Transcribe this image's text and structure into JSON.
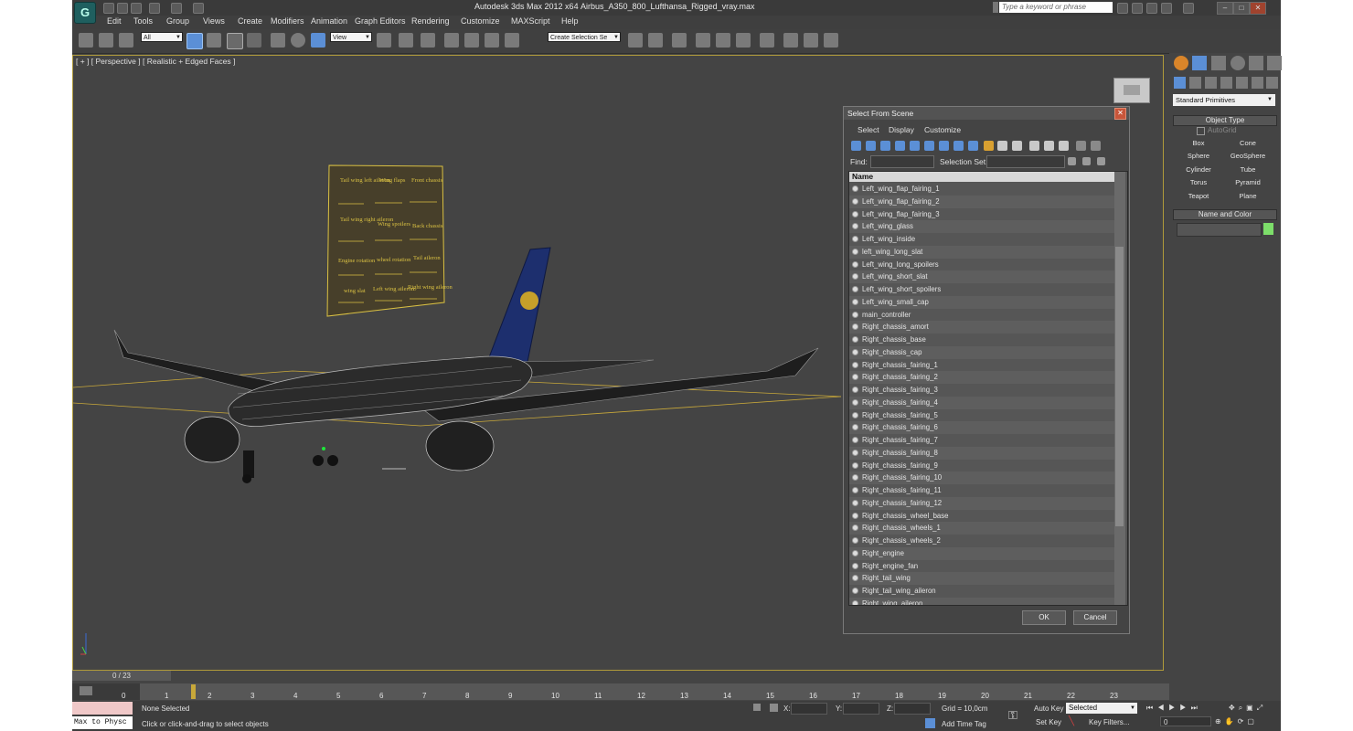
{
  "app": {
    "title": "Autodesk 3ds Max  2012 x64",
    "file": "Airbus_A350_800_Lufthansa_Rigged_vray.max",
    "search_placeholder": "Type a keyword or phrase"
  },
  "menu": [
    "Edit",
    "Tools",
    "Group",
    "Views",
    "Create",
    "Modifiers",
    "Animation",
    "Graph Editors",
    "Rendering",
    "Customize",
    "MAXScript",
    "Help"
  ],
  "toolbar": {
    "filter_value": "All",
    "view_value": "View",
    "selection_set_value": "Create Selection Se"
  },
  "viewport": {
    "label": "[ + ] [ Perspective ] [ Realistic + Edged Faces ]",
    "controller_labels": [
      "Tail wing left aileron",
      "Wing flaps",
      "Front chassis",
      "Tail wing right aileron",
      "Wing spoilers",
      "Back chassis",
      "Engine rotation",
      "wheel rotation",
      "Tail aileron",
      "wing slat",
      "Left wing aileron",
      "Right wing aileron"
    ]
  },
  "dialog": {
    "title": "Select From Scene",
    "menu": [
      "Select",
      "Display",
      "Customize"
    ],
    "find_label": "Find:",
    "selection_set_label": "Selection Set:",
    "column_header": "Name",
    "items": [
      "Left_wing_flap_fairing_1",
      "Left_wing_flap_fairing_2",
      "Left_wing_flap_fairing_3",
      "Left_wing_glass",
      "Left_wing_inside",
      "left_wing_long_slat",
      "Left_wing_long_spoilers",
      "Left_wing_short_slat",
      "Left_wing_short_spoilers",
      "Left_wing_small_cap",
      "main_controller",
      "Right_chassis_amort",
      "Right_chassis_base",
      "Right_chassis_cap",
      "Right_chassis_fairing_1",
      "Right_chassis_fairing_2",
      "Right_chassis_fairing_3",
      "Right_chassis_fairing_4",
      "Right_chassis_fairing_5",
      "Right_chassis_fairing_6",
      "Right_chassis_fairing_7",
      "Right_chassis_fairing_8",
      "Right_chassis_fairing_9",
      "Right_chassis_fairing_10",
      "Right_chassis_fairing_11",
      "Right_chassis_fairing_12",
      "Right_chassis_wheel_base",
      "Right_chassis_wheels_1",
      "Right_chassis_wheels_2",
      "Right_engine",
      "Right_engine_fan",
      "Right_tail_wing",
      "Right_tail_wing_aileron",
      "Right_wing_aileron"
    ],
    "ok_label": "OK",
    "cancel_label": "Cancel"
  },
  "command_panel": {
    "category": "Standard Primitives",
    "object_type_title": "Object Type",
    "autogrid_label": "AutoGrid",
    "primitives": [
      "Box",
      "Cone",
      "Sphere",
      "GeoSphere",
      "Cylinder",
      "Tube",
      "Torus",
      "Pyramid",
      "Teapot",
      "Plane"
    ],
    "name_color_title": "Name and Color",
    "color_swatch": "#7dde6a"
  },
  "timeline": {
    "slider_label": "0 / 23",
    "ticks": [
      "0",
      "1",
      "2",
      "3",
      "4",
      "5",
      "6",
      "7",
      "8",
      "9",
      "10",
      "11",
      "12",
      "13",
      "14",
      "15",
      "16",
      "17",
      "18",
      "19",
      "20",
      "21",
      "22",
      "23"
    ]
  },
  "status": {
    "script_listener": "Max to Physc",
    "selection": "None Selected",
    "prompt": "Click or click-and-drag to select objects",
    "x_label": "X:",
    "y_label": "Y:",
    "z_label": "Z:",
    "grid": "Grid = 10,0cm",
    "add_time_tag": "Add Time Tag",
    "auto_key": "Auto Key",
    "set_key": "Set Key",
    "key_mode": "Selected",
    "key_filters": "Key Filters...",
    "frame": "0"
  },
  "colors": {
    "accent": "#b09a3a",
    "controller_panel": "#d9c043",
    "script_box": "#f0c8c8"
  }
}
